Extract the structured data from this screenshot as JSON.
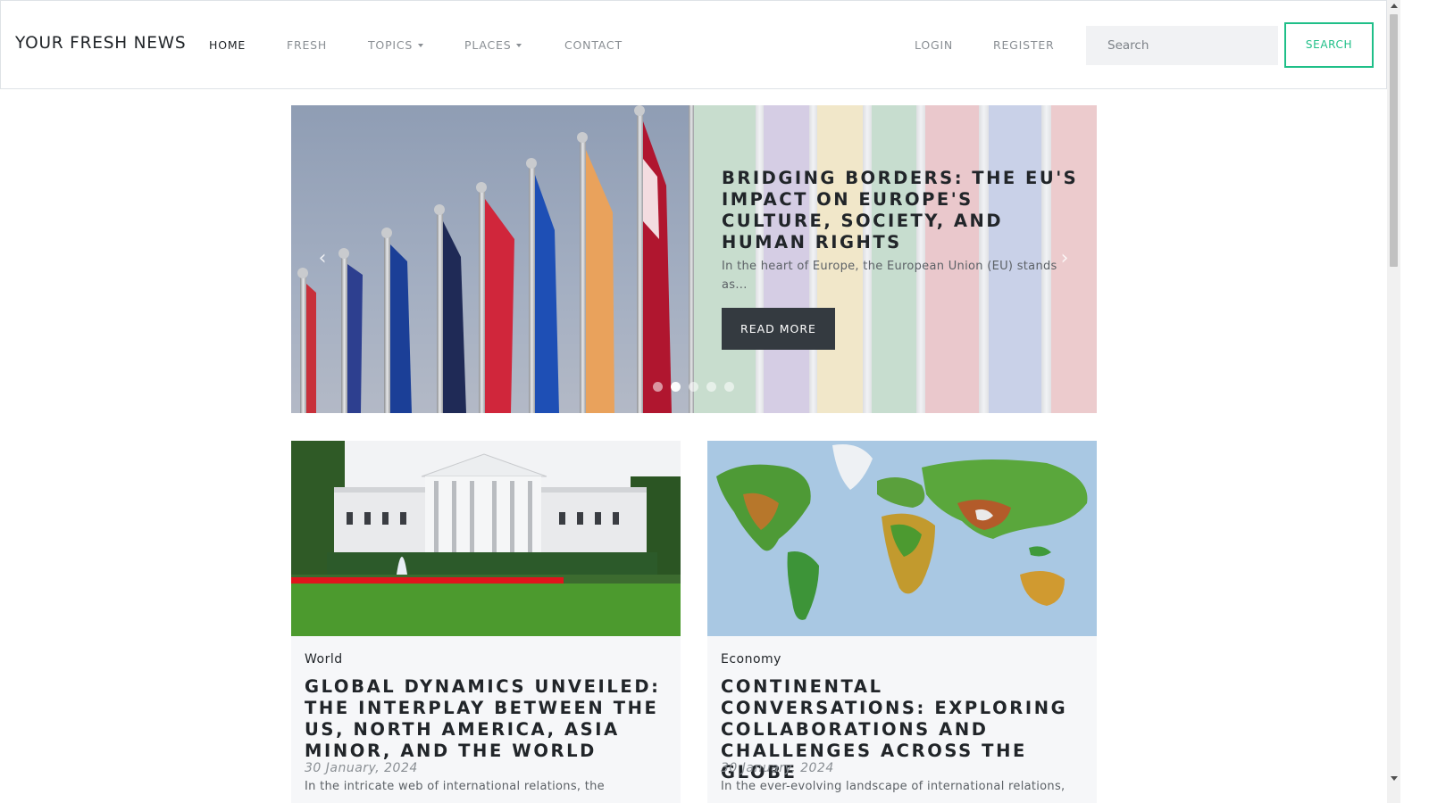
{
  "brand": "YOUR FRESH NEWS",
  "nav": {
    "home": "HOME",
    "fresh": "FRESH",
    "topics": "TOPICS",
    "places": "PLACES",
    "contact": "CONTACT",
    "login": "LOGIN",
    "register": "REGISTER"
  },
  "search": {
    "placeholder": "Search",
    "button": "SEARCH"
  },
  "hero": {
    "title": "BRIDGING BORDERS: THE EU'S IMPACT ON EUROPE'S CULTURE, SOCIETY, AND HUMAN RIGHTS",
    "excerpt": "In the heart of Europe, the European Union (EU) stands as...",
    "button": "READ MORE",
    "prev_icon": "‹",
    "next_icon": "›",
    "slide_count": 5,
    "active_slide": 2
  },
  "cards": [
    {
      "category": "World",
      "title": "GLOBAL DYNAMICS UNVEILED: THE INTERPLAY BETWEEN THE US, NORTH AMERICA, ASIA MINOR, AND THE WORLD",
      "date": "30 January, 2024",
      "excerpt": "In the intricate web of international relations, the"
    },
    {
      "category": "Economy",
      "title": "CONTINENTAL CONVERSATIONS: EXPLORING COLLABORATIONS AND CHALLENGES ACROSS THE GLOBE",
      "date": "30 January, 2024",
      "excerpt": "In the ever-evolving landscape of international relations,"
    }
  ],
  "colors": {
    "accent": "#1fbf88",
    "dark_button": "#343a40",
    "card_bg": "#f6f7f9"
  }
}
